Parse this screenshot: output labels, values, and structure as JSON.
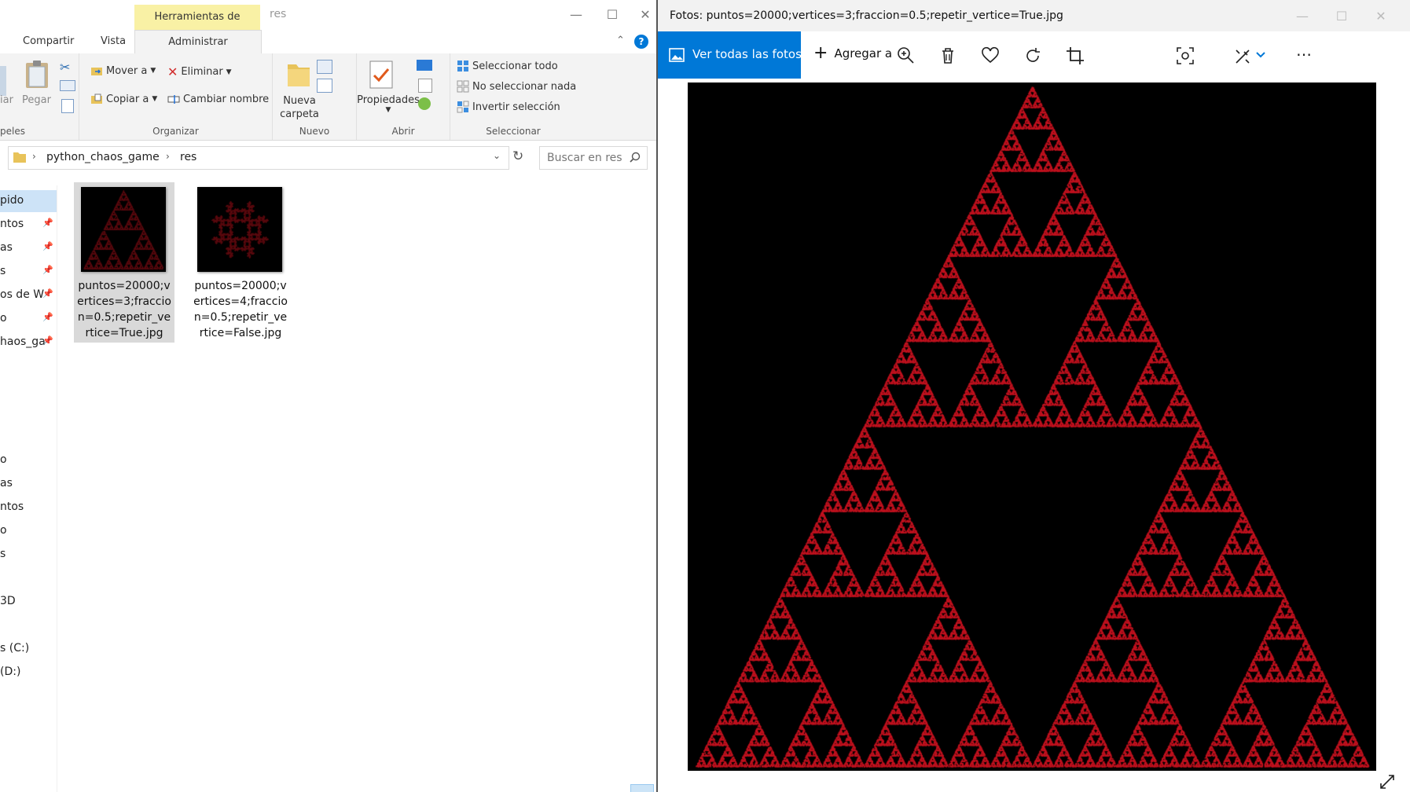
{
  "explorer": {
    "context_tab_header": "Herramientas de imagen",
    "window_title": "res",
    "tabs": [
      {
        "label": "Compartir"
      },
      {
        "label": "Vista"
      },
      {
        "label": "Administrar"
      }
    ],
    "ribbon": {
      "clipboard": {
        "partial_left": "iar",
        "pegar": "Pegar",
        "group_label": "peles"
      },
      "organizar": {
        "mover": "Mover a",
        "copiar": "Copiar a",
        "eliminar": "Eliminar",
        "cambiar": "Cambiar nombre",
        "group_label": "Organizar"
      },
      "nuevo": {
        "nueva_carpeta_line1": "Nueva",
        "nueva_carpeta_line2": "carpeta",
        "group_label": "Nuevo"
      },
      "abrir": {
        "propiedades": "Propiedades",
        "group_label": "Abrir"
      },
      "seleccionar": {
        "todo": "Seleccionar todo",
        "nada": "No seleccionar nada",
        "invertir": "Invertir selección",
        "group_label": "Seleccionar"
      }
    },
    "address": {
      "crumbs": [
        "python_chaos_game",
        "res"
      ]
    },
    "search": {
      "placeholder": "Buscar en res"
    },
    "nav": [
      {
        "label": "pido",
        "pinned": false,
        "selected": true
      },
      {
        "label": "ntos",
        "pinned": true
      },
      {
        "label": "as",
        "pinned": true
      },
      {
        "label": "s",
        "pinned": true
      },
      {
        "label": "os de W",
        "pinned": true
      },
      {
        "label": "o",
        "pinned": true
      },
      {
        "label": "haos_ga",
        "pinned": true
      },
      {
        "label": "o"
      },
      {
        "label": "as"
      },
      {
        "label": "ntos"
      },
      {
        "label": "o"
      },
      {
        "label": "s"
      },
      {
        "label": "3D"
      },
      {
        "label": "s (C:)"
      },
      {
        "label": " (D:)"
      }
    ],
    "files": [
      {
        "name": "puntos=20000;vertices=3;fraccion=0.5;repetir_vertice=True.jpg",
        "selected": true
      },
      {
        "name": "puntos=20000;vertices=4;fraccion=0.5;repetir_vertice=False.jpg",
        "selected": false
      }
    ]
  },
  "photos": {
    "title": "Fotos: puntos=20000;vertices=3;fraccion=0.5;repetir_vertice=True.jpg",
    "toolbar": {
      "ver_todas": "Ver todas las fotos",
      "agregar": "Agregar a",
      "more": "…"
    },
    "accent_color": "#0078d7",
    "image": {
      "background": "#000000",
      "point_color": "#c1121f",
      "points": 20000,
      "vertices": 3,
      "fraction": 0.5
    }
  }
}
